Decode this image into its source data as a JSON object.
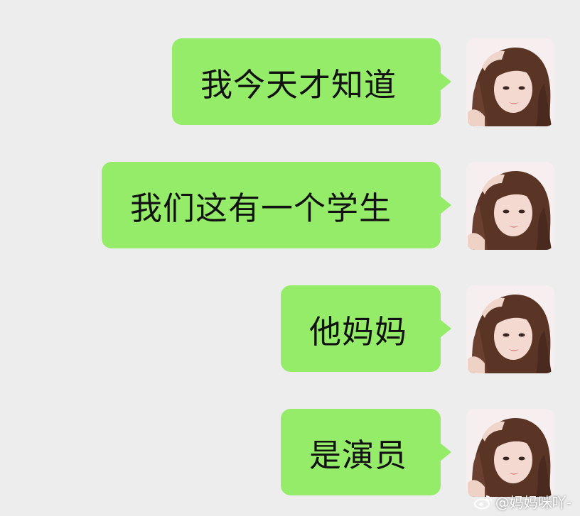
{
  "messages": [
    {
      "text": "我今天才知道",
      "sender": "self",
      "avatar_icon": "user-avatar-icon"
    },
    {
      "text": "我们这有一个学生",
      "sender": "self",
      "avatar_icon": "user-avatar-icon"
    },
    {
      "text": "他妈妈",
      "sender": "self",
      "avatar_icon": "user-avatar-icon"
    },
    {
      "text": "是演员",
      "sender": "self",
      "avatar_icon": "user-avatar-icon"
    }
  ],
  "watermark": {
    "text": "@妈妈咪吖-",
    "icon": "weibo-logo-icon"
  },
  "colors": {
    "background": "#ededed",
    "bubble": "#95ec69",
    "text": "#111111"
  }
}
